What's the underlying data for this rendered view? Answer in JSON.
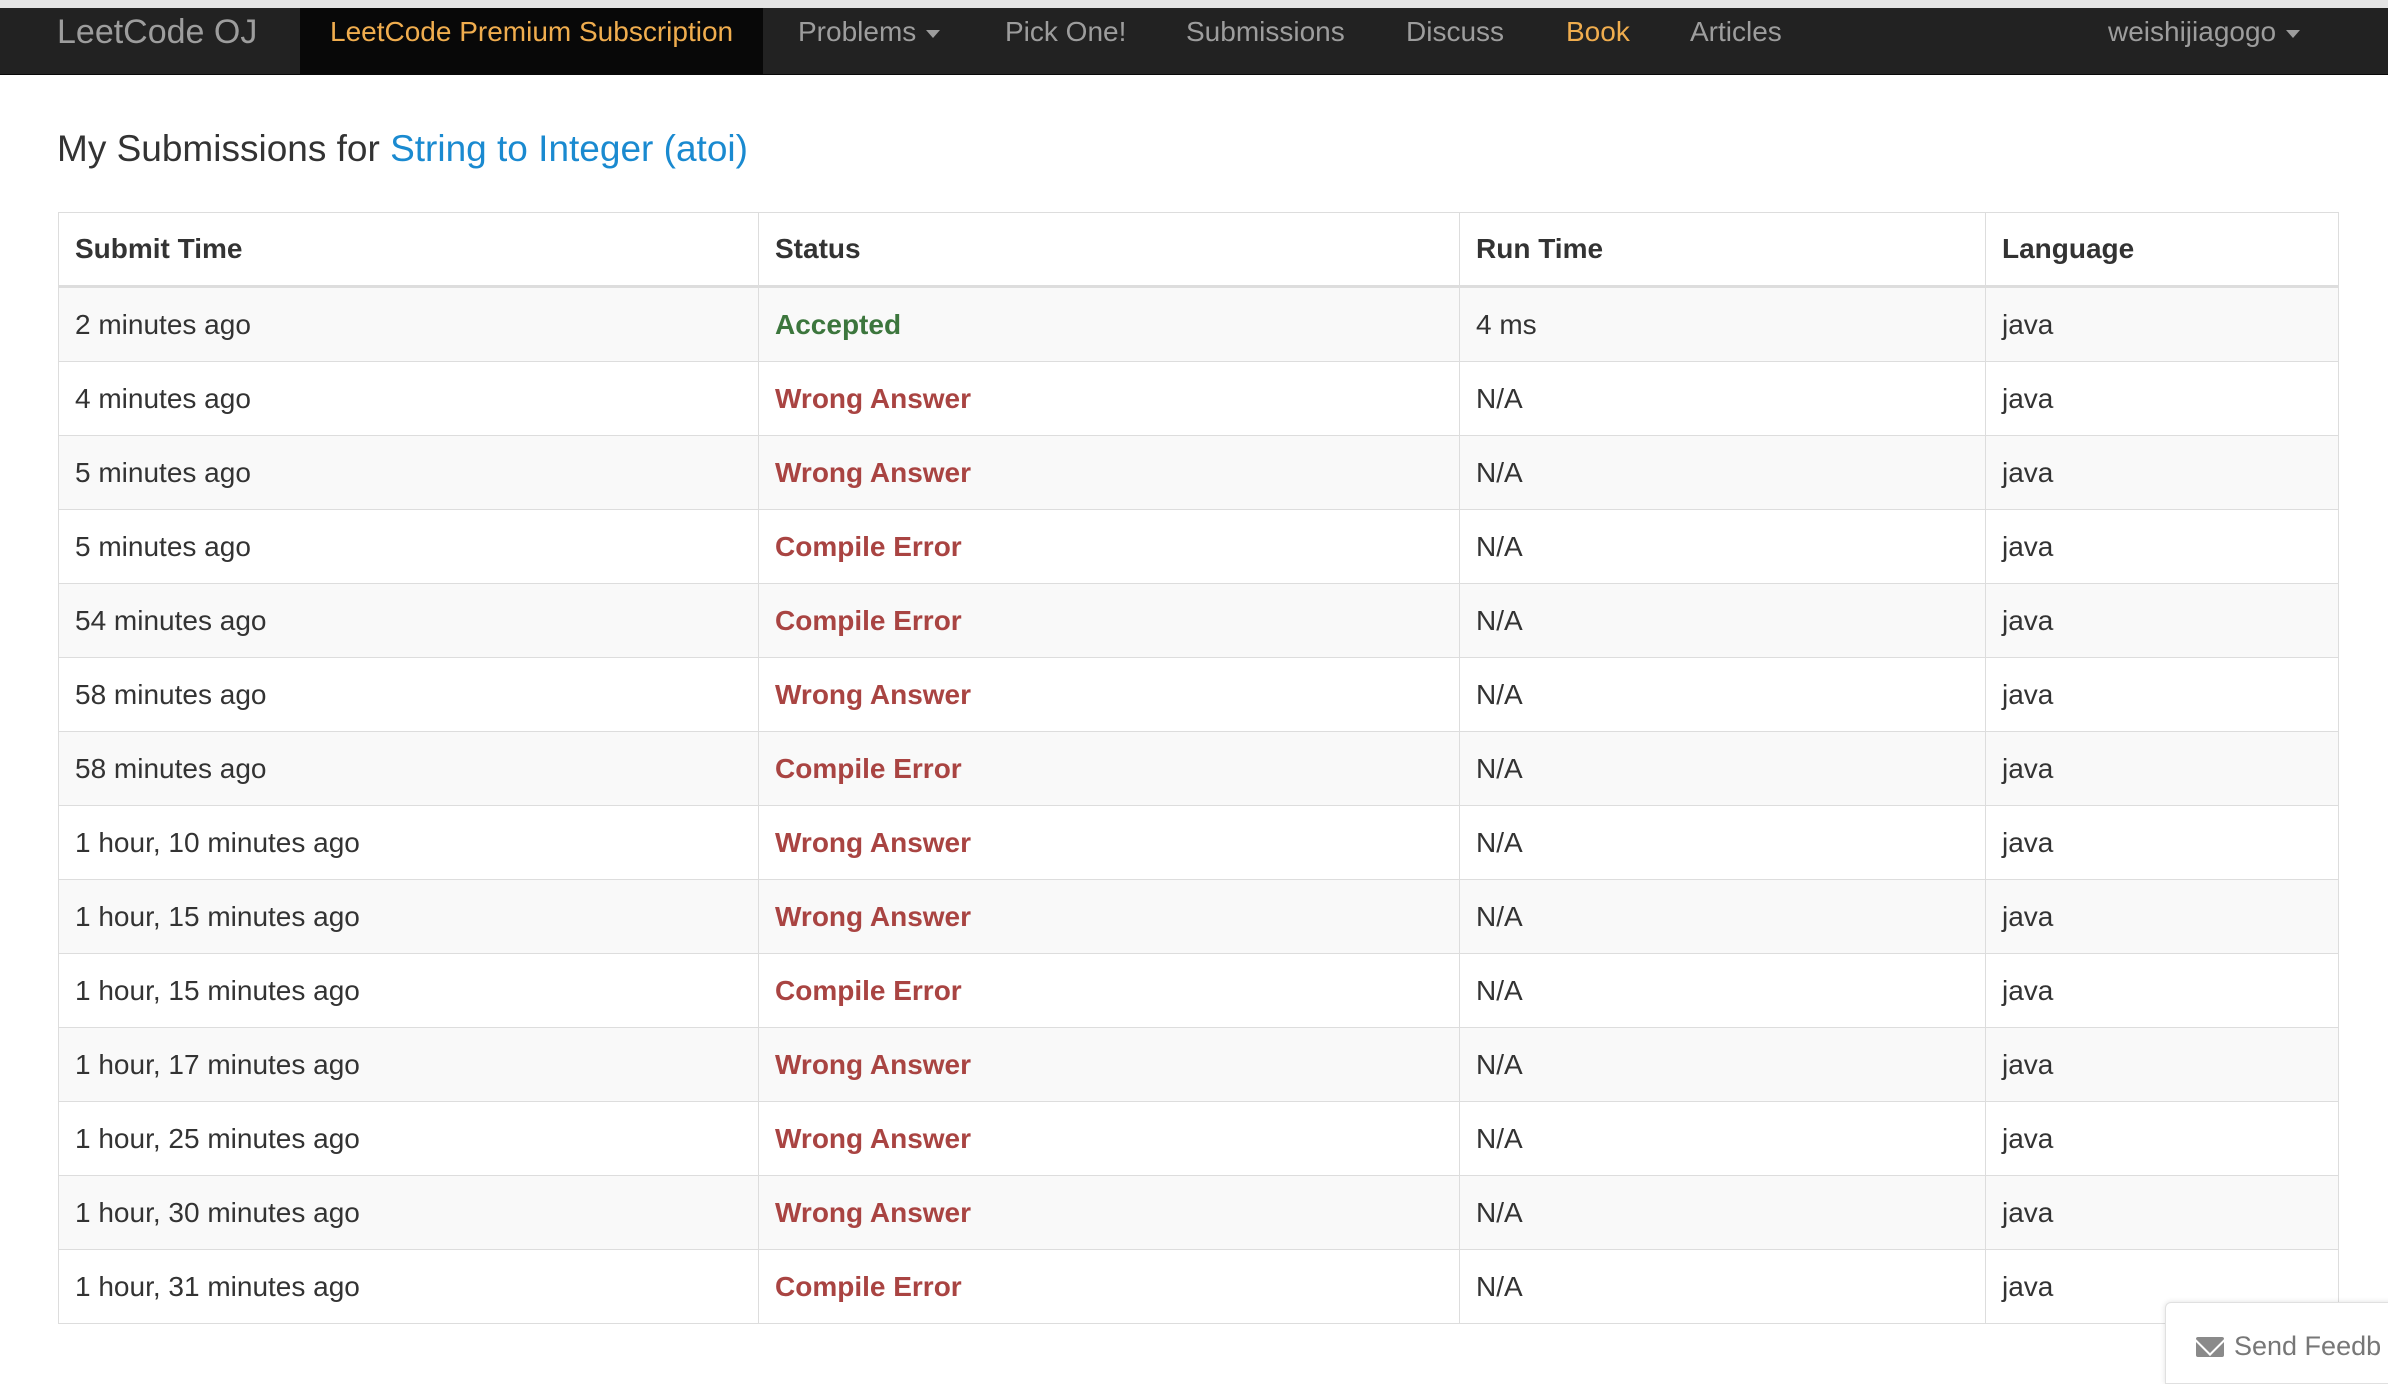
{
  "navbar": {
    "brand": "LeetCode OJ",
    "premium": "LeetCode Premium Subscription",
    "problems": "Problems",
    "pick_one": "Pick One!",
    "submissions": "Submissions",
    "discuss": "Discuss",
    "book": "Book",
    "articles": "Articles",
    "user": "weishijiagogo"
  },
  "page": {
    "title_prefix": "My Submissions for",
    "problem_name": "String to Integer (atoi)"
  },
  "table": {
    "headers": [
      "Submit Time",
      "Status",
      "Run Time",
      "Language"
    ],
    "rows": [
      {
        "time": "2 minutes ago",
        "status": "Accepted",
        "runtime": "4 ms",
        "language": "java"
      },
      {
        "time": "4 minutes ago",
        "status": "Wrong Answer",
        "runtime": "N/A",
        "language": "java"
      },
      {
        "time": "5 minutes ago",
        "status": "Wrong Answer",
        "runtime": "N/A",
        "language": "java"
      },
      {
        "time": "5 minutes ago",
        "status": "Compile Error",
        "runtime": "N/A",
        "language": "java"
      },
      {
        "time": "54 minutes ago",
        "status": "Compile Error",
        "runtime": "N/A",
        "language": "java"
      },
      {
        "time": "58 minutes ago",
        "status": "Wrong Answer",
        "runtime": "N/A",
        "language": "java"
      },
      {
        "time": "58 minutes ago",
        "status": "Compile Error",
        "runtime": "N/A",
        "language": "java"
      },
      {
        "time": "1 hour, 10 minutes ago",
        "status": "Wrong Answer",
        "runtime": "N/A",
        "language": "java"
      },
      {
        "time": "1 hour, 15 minutes ago",
        "status": "Wrong Answer",
        "runtime": "N/A",
        "language": "java"
      },
      {
        "time": "1 hour, 15 minutes ago",
        "status": "Compile Error",
        "runtime": "N/A",
        "language": "java"
      },
      {
        "time": "1 hour, 17 minutes ago",
        "status": "Wrong Answer",
        "runtime": "N/A",
        "language": "java"
      },
      {
        "time": "1 hour, 25 minutes ago",
        "status": "Wrong Answer",
        "runtime": "N/A",
        "language": "java"
      },
      {
        "time": "1 hour, 30 minutes ago",
        "status": "Wrong Answer",
        "runtime": "N/A",
        "language": "java"
      },
      {
        "time": "1 hour, 31 minutes ago",
        "status": "Compile Error",
        "runtime": "N/A",
        "language": "java"
      }
    ]
  },
  "feedback": {
    "label": "Send Feedb",
    "icon": "envelope-icon"
  },
  "colors": {
    "navbar_bg": "#222222",
    "accent_orange": "#f0ad4e",
    "link_blue": "#1a8ad0",
    "accepted_green": "#3c763d",
    "error_red": "#a94442"
  }
}
